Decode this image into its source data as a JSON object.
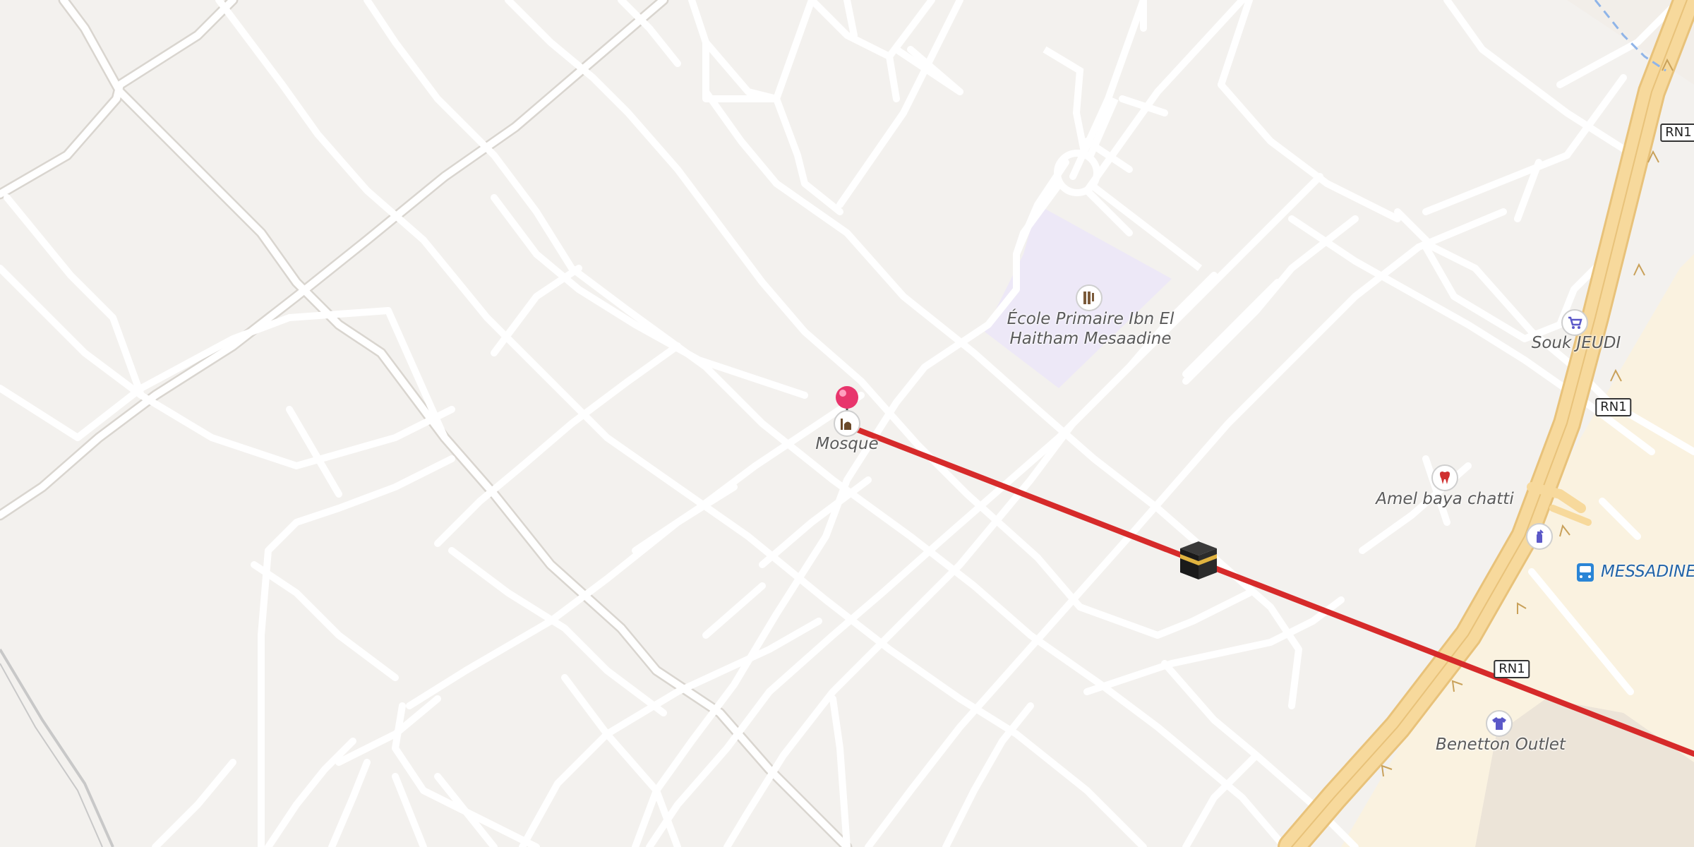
{
  "labels": {
    "school": "École Primaire Ibn El Haitham Mesaadine",
    "school_line1": "École Primaire Ibn El",
    "school_line2": "Haitham Mesaadine",
    "mosque": "Mosque",
    "souk": "Souk JEUDI",
    "dentist": "Amel baya chatti",
    "bus_stop": "MESSADINE",
    "shop": "Benetton Outlet"
  },
  "road_shields": [
    "RN1",
    "RN1",
    "RN1"
  ],
  "icons": {
    "school": "school-icon",
    "mosque": "mosque-icon",
    "souk": "shopping-cart-icon",
    "dentist": "tooth-icon",
    "pharmacy": "pharmacy-icon",
    "bus": "bus-stop-icon",
    "clothes": "clothes-shop-icon",
    "pin": "location-pin-icon",
    "qibla": "kaaba-icon"
  },
  "colors": {
    "background": "#f2efe9",
    "road": "#ffffff",
    "highway": "#f7d89a",
    "school_area": "#ede8f7",
    "qibla_line": "#d62a2a",
    "pin": "#e8356c",
    "bus": "#2a85d6"
  }
}
